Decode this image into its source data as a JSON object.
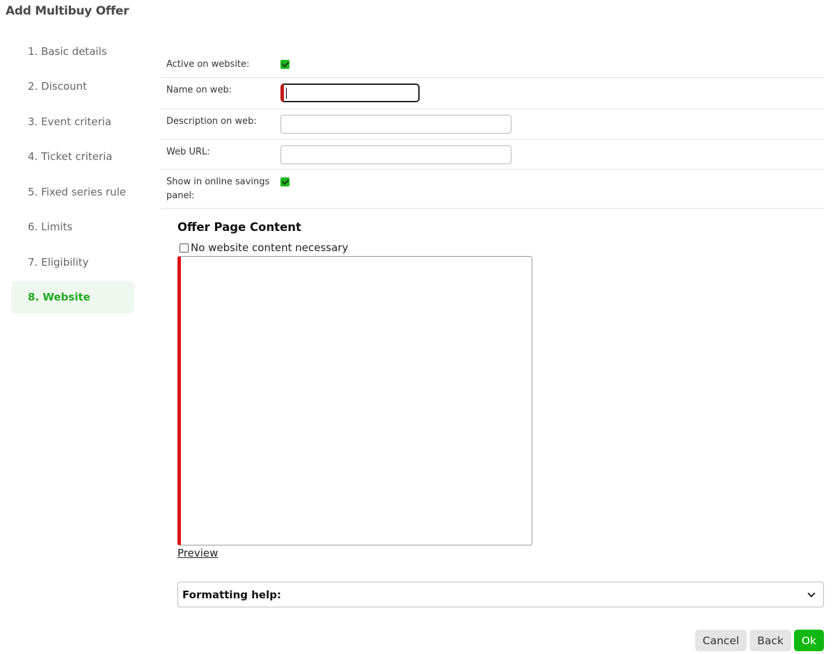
{
  "title": "Add Multibuy Offer",
  "steps": [
    {
      "label": "1. Basic details"
    },
    {
      "label": "2. Discount"
    },
    {
      "label": "3. Event criteria"
    },
    {
      "label": "4. Ticket criteria"
    },
    {
      "label": "5. Fixed series rule"
    },
    {
      "label": "6. Limits"
    },
    {
      "label": "7. Eligibility"
    },
    {
      "label": "8. Website",
      "active": true
    }
  ],
  "form": {
    "active_label": "Active on website:",
    "active_checked": true,
    "name_label": "Name on web:",
    "name_value": "",
    "description_label": "Description on web:",
    "description_value": "",
    "url_label": "Web URL:",
    "url_value": "",
    "savings_label_line1": "Show in online savings",
    "savings_label_line2": "panel:",
    "savings_checked": true
  },
  "content": {
    "title": "Offer Page Content",
    "no_content_label": "No website content necessary",
    "no_content_checked": false,
    "editor_value": "",
    "preview_label": "Preview",
    "formatting_label": "Formatting help:"
  },
  "buttons": {
    "cancel": "Cancel",
    "back": "Back",
    "ok": "Ok"
  },
  "colors": {
    "accent_green": "#12b812",
    "active_step_bg": "#eef8ee",
    "error_red": "#e01010"
  }
}
